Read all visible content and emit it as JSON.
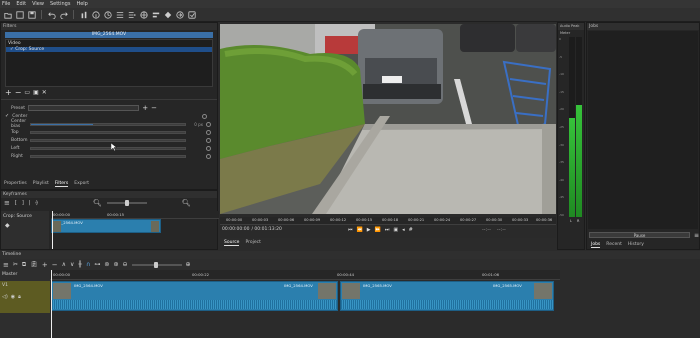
{
  "menu": [
    "File",
    "Edit",
    "View",
    "Settings",
    "Help"
  ],
  "toolbar_icons": [
    "open-icon",
    "recent-icon",
    "save-icon",
    "undo-icon",
    "redo-icon",
    "peak-meter-icon",
    "properties-icon",
    "recent-list-icon",
    "playlist-icon",
    "history-icon",
    "filters-icon",
    "timeline-icon",
    "keyframes-icon",
    "export-icon",
    "jobs-icon"
  ],
  "filters_panel": {
    "title": "Filters",
    "clip_name": "IMG_2564.MOV",
    "section": "Video",
    "selected_filter": "Crop: Source",
    "preset_label": "Preset",
    "center_label": "Center",
    "center_bias_label": "Center bias",
    "center_bias_value": "0 px",
    "top_label": "Top",
    "bottom_label": "Bottom",
    "left_label": "Left",
    "right_label": "Right",
    "tabs": [
      "Properties",
      "Playlist",
      "Filters",
      "Export"
    ],
    "active_tab": "Filters"
  },
  "keyframes": {
    "title": "Keyframes",
    "track_label": "Crop: Source",
    "t0": "00:00:00",
    "t1": "00:00:15"
  },
  "player": {
    "ruler": [
      "00:00:00",
      "00:00:03",
      "00:00:06",
      "00:00:09",
      "00:00:12",
      "00:00:15",
      "00:00:18",
      "00:00:21",
      "00:00:24",
      "00:00:27",
      "00:00:30",
      "00:00:33",
      "00:00:36"
    ],
    "timecode": "00:00:00:00",
    "duration": "/ 00:01:13:20",
    "tabs": [
      "Source",
      "Project"
    ],
    "active_tab": "Source"
  },
  "audio_panel": {
    "title": "Audio Peak Meter",
    "scale": [
      "0",
      "-5",
      "-10",
      "-15",
      "-20",
      "-25",
      "-30",
      "-35",
      "-40",
      "-45",
      "-50"
    ],
    "channels": [
      "L",
      "R"
    ],
    "levels": [
      0.55,
      0.62
    ]
  },
  "jobs_panel": {
    "title": "Jobs",
    "pause_label": "Pause",
    "tabs": [
      "Jobs",
      "Recent",
      "History"
    ]
  },
  "timeline": {
    "title": "Timeline",
    "master_label": "Master",
    "track_label": "V1",
    "ruler": [
      "00:00:00",
      "00:00:22",
      "00:00:44",
      "00:01:06",
      "00:01:28"
    ],
    "clips": [
      {
        "name": "IMG_2564.MOV",
        "end_name": "IMG_2564.MOV"
      },
      {
        "name": "IMG_2565.MOV",
        "end_name": "IMG_2565.MOV"
      }
    ]
  },
  "colors": {
    "accent": "#2b7fae",
    "selection": "#1f4e8a",
    "track_header": "#5d5b22",
    "meter": "#36c23a"
  }
}
